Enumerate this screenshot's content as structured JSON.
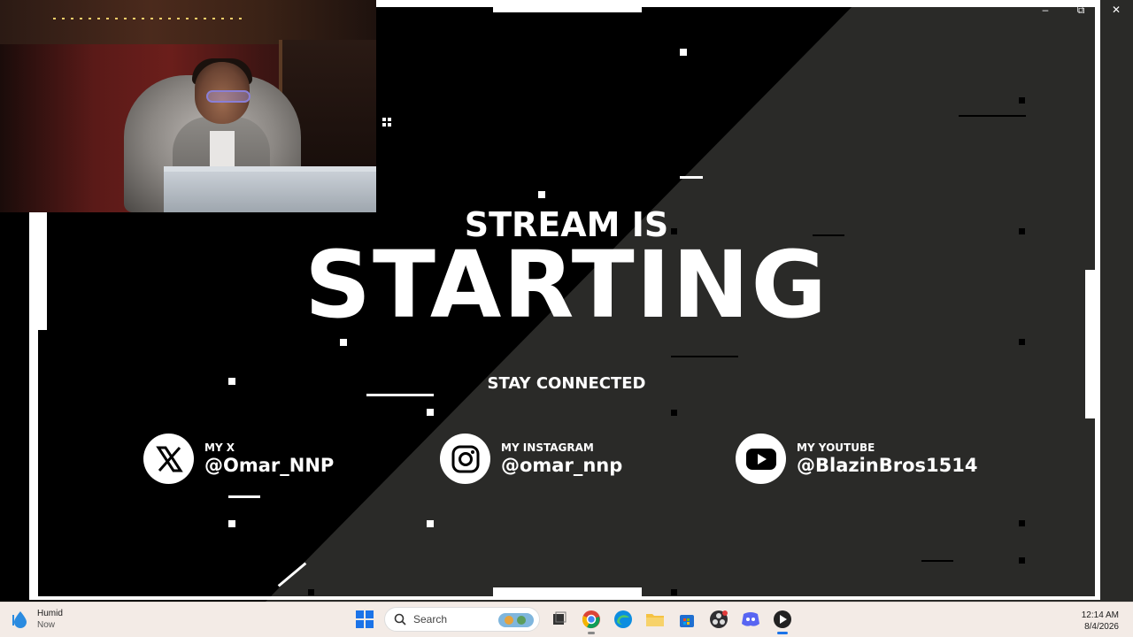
{
  "stream": {
    "title_top": "STREAM IS",
    "title_main": "STARTING",
    "stay_connected": "STAY CONNECTED",
    "socials": [
      {
        "label": "MY X",
        "handle": "@Omar_NNP",
        "icon": "x-logo-icon"
      },
      {
        "label": "MY INSTAGRAM",
        "handle": "@omar_nnp",
        "icon": "instagram-icon"
      },
      {
        "label": "MY YOUTUBE",
        "handle": "@BlazinBros1514",
        "icon": "youtube-icon"
      }
    ],
    "colors": {
      "dark_half": "#000000",
      "light_half": "#2a2a28",
      "accent": "#ffffff"
    }
  },
  "window_controls": {
    "minimize": "–",
    "restore": "⧉",
    "close": "✕"
  },
  "taskbar": {
    "weather_title": "Humid",
    "weather_sub": "Now",
    "search_placeholder": "Search",
    "time": "12:14 AM",
    "date": "8/4/2026",
    "apps": [
      "start-icon",
      "search-icon",
      "task-view-icon",
      "chrome-icon",
      "edge-icon",
      "file-explorer-icon",
      "store-icon",
      "obs-icon",
      "discord-icon",
      "media-player-icon"
    ]
  }
}
